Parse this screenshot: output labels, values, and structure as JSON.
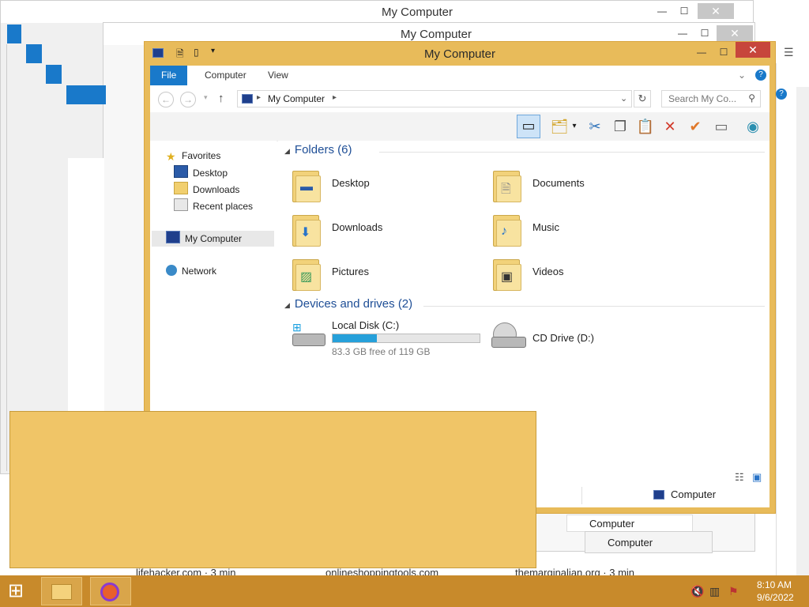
{
  "app": {
    "window_title": "My Computer",
    "stack_titles": [
      "My Computer",
      "My Computer"
    ]
  },
  "ribbon": {
    "tabs": [
      "File",
      "Computer",
      "View"
    ]
  },
  "address": {
    "path": "My Computer",
    "search_placeholder": "Search My Co..."
  },
  "nav": {
    "favorites": "Favorites",
    "desktop": "Desktop",
    "downloads": "Downloads",
    "recent": "Recent places",
    "computer": "My Computer",
    "network": "Network"
  },
  "content": {
    "folders_header": "Folders (6)",
    "folders": [
      {
        "name": "Desktop",
        "icon": "desktop-folder-icon"
      },
      {
        "name": "Documents",
        "icon": "documents-folder-icon"
      },
      {
        "name": "Downloads",
        "icon": "downloads-folder-icon"
      },
      {
        "name": "Music",
        "icon": "music-folder-icon"
      },
      {
        "name": "Pictures",
        "icon": "pictures-folder-icon"
      },
      {
        "name": "Videos",
        "icon": "videos-folder-icon"
      }
    ],
    "devices_header": "Devices and drives (2)",
    "drives": [
      {
        "name": "Local Disk (C:)",
        "free": "83.3 GB free of 119 GB",
        "used_fraction": 0.3,
        "icon": "hard-drive-icon"
      },
      {
        "name": "CD Drive (D:)",
        "icon": "cd-drive-icon"
      }
    ]
  },
  "status": {
    "location": "Computer",
    "stack_locations": [
      "Computer",
      "Computer"
    ],
    "partial_location": "puter"
  },
  "background_links": [
    "lifehacker.com · 3 min",
    "onlineshoppingtools.com",
    "themarginalian.org · 3 min"
  ],
  "tray": {
    "time": "8:10 AM",
    "date": "9/6/2022"
  },
  "colors": {
    "accent": "#1979ca",
    "window_border": "#e8bb5a",
    "overlay": "#f0c567",
    "taskbar": "#c88a2b",
    "close_button": "#c7463c"
  }
}
